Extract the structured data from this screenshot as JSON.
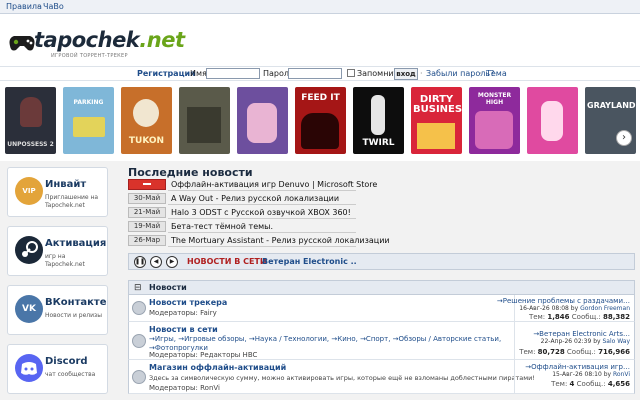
{
  "topnav": {
    "rules": "Правила",
    "sep": "·",
    "faq": "ЧаВо"
  },
  "logo": {
    "name": "tapochek",
    "tld": ".net",
    "tagline": "ИГРОВОЙ ТОРРЕНТ-ТРЕКЕР"
  },
  "login": {
    "register": "Регистрация",
    "name_label": "Имя:",
    "password_label": "Пароль:",
    "remember": "Запомнить",
    "enter_button": "вход",
    "forgot": "Забыли пароль?",
    "theme": "Тема",
    "dot": "·"
  },
  "covers": [
    {
      "caption": "UNPOSSESS 2",
      "bg": "#2b2f3a"
    },
    {
      "caption": "PARKING",
      "bg": "#7fb7d8"
    },
    {
      "caption": "TUKON",
      "bg": "#c76f2a"
    },
    {
      "caption": "",
      "bg": "#5a5a4a"
    },
    {
      "caption": "",
      "bg": "#6d4f9e"
    },
    {
      "caption": "FEED IT",
      "bg": "#a51616"
    },
    {
      "caption": "TWIRL",
      "bg": "#0d0d0d"
    },
    {
      "caption": "DIRTY BUSINESS",
      "bg": "#d9253a"
    },
    {
      "caption": "MONSTER HIGH",
      "bg": "#8e2a9c"
    },
    {
      "caption": "",
      "bg": "#e04aa0"
    },
    {
      "caption": "GRAYLAND",
      "bg": "#4a5560"
    }
  ],
  "sidebar": [
    {
      "title": "Инвайт",
      "sub": "Приглашение на Tapochek.net",
      "icon": "VIP",
      "color": "#e3a43a"
    },
    {
      "title": "Активация",
      "sub": "игр на Tapochek.net",
      "icon": "S",
      "color": "#1b2838"
    },
    {
      "title": "ВКонтакте",
      "sub": "Новости и релизы",
      "icon": "VK",
      "color": "#4a76a8"
    },
    {
      "title": "Discord",
      "sub": "чат сообщества",
      "icon": "D",
      "color": "#5865f2"
    }
  ],
  "news": {
    "title": "Последние новости",
    "items": [
      {
        "date": "",
        "text": "Оффлайн-активация игр Denuvo | Microsoft Store",
        "hot": true
      },
      {
        "date": "30-Май",
        "text": "A Way Out - Релиз русской локализации"
      },
      {
        "date": "21-Май",
        "text": "Halo 3 ODST с Русской озвучкой XBOX 360!"
      },
      {
        "date": "19-Май",
        "text": "Бета-тест тёмной темы."
      },
      {
        "date": "26-Мар",
        "text": "The Mortuary Assistant - Релиз русской локализации"
      }
    ]
  },
  "player": {
    "label": "НОВОСТИ В СЕТИ",
    "marquee": "Ветеран Electronic .."
  },
  "forum": {
    "section": "Новости",
    "rows": [
      {
        "name": "Новости трекера",
        "moderators": "Модераторы: Fairy",
        "last_title": "→Решение проблемы с раздачами…",
        "last_date": "16-Авг-26 08:08 by",
        "last_user": "Gordon Freeman",
        "topics": "1,846",
        "posts": "88,382"
      },
      {
        "name": "Новости в сети",
        "subforums": "→Игры, →Игровые обзоры, →Наука / Технологии, →Кино, →Спорт, →Обзоры / Авторские статьи, →Фотопрогулки",
        "moderators": "Модераторы: Редакторы HBC",
        "last_title": "→Ветеран Electronic Arts…",
        "last_date": "22-Апр-26 02:39 by",
        "last_user": "Salo Way",
        "topics": "80,728",
        "posts": "716,966"
      },
      {
        "name": "Магазин оффлайн-активаций",
        "desc": "Здесь за символическую сумму, можно активировать игры, которые ещё не взломаны доблестными пиратами!",
        "moderators": "Модераторы: RonVi",
        "last_title": "→Оффлайн-активация игр…",
        "last_date": "15-Авг-26 08:10 by",
        "last_user": "RonVi",
        "topics": "4",
        "posts": "4,656"
      }
    ],
    "topics_label": "Тем:",
    "posts_label": "Сообщ.:"
  }
}
